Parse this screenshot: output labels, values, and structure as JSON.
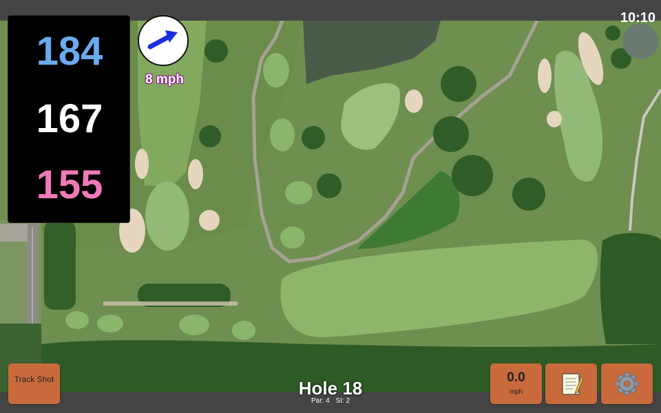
{
  "status": {
    "clock": "10:10"
  },
  "yardages": {
    "back": "184",
    "middle": "167",
    "front": "155"
  },
  "wind": {
    "speed_label": "8 mph",
    "direction_icon": "arrow-right-icon",
    "arrow_color": "#1a2ee0"
  },
  "buttons": {
    "track_shot": "Track Shot",
    "speed_value": "0.0",
    "speed_unit": "mph",
    "notes_icon": "notepad-icon",
    "settings_icon": "gear-icon"
  },
  "hole": {
    "title": "Hole 18",
    "par": "Par: 4",
    "si": "SI: 2"
  },
  "colors": {
    "button": "#c96a3c",
    "back_yardage": "#6aaaf0",
    "middle_yardage": "#ffffff",
    "front_yardage": "#f07ab8"
  }
}
